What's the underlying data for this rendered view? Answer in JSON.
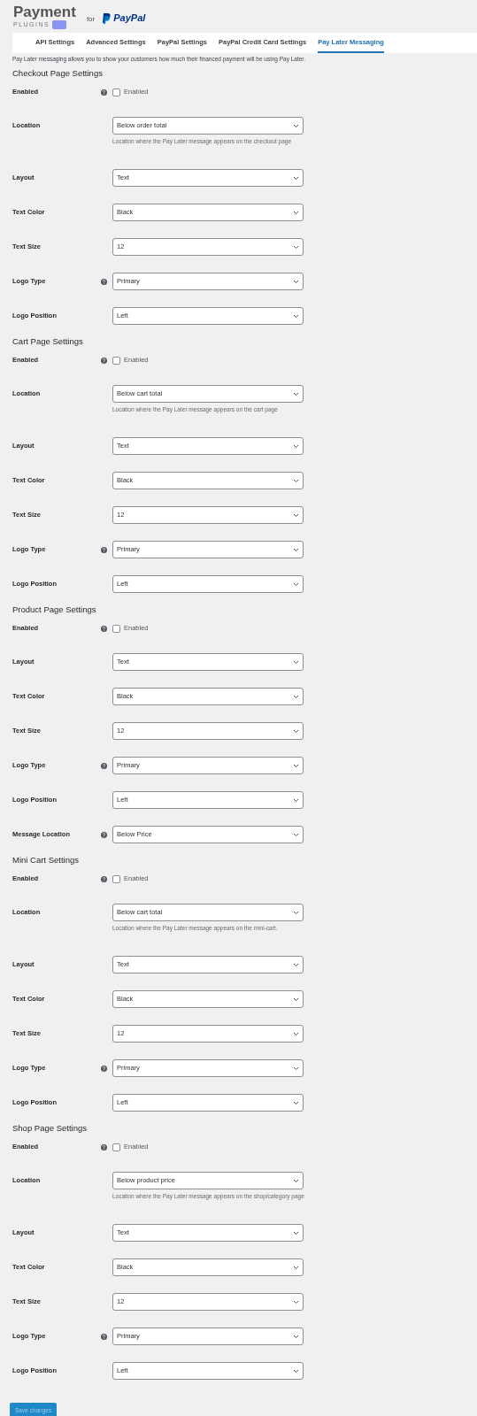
{
  "header": {
    "brand_top": "Payment",
    "brand_bottom": "PLUGINS",
    "connector": "for",
    "partner": "PayPal"
  },
  "tabs": [
    {
      "label": "API Settings",
      "selected": false
    },
    {
      "label": "Advanced Settings",
      "selected": false
    },
    {
      "label": "PayPal Settings",
      "selected": false
    },
    {
      "label": "PayPal Credit Card Settings",
      "selected": false
    },
    {
      "label": "Pay Later Messaging",
      "selected": true
    }
  ],
  "intro": "Pay Later messaging allows you to show your customers how much their financed payment will be using Pay Later.",
  "sections": [
    {
      "title": "Checkout Page Settings",
      "fields": [
        {
          "kind": "checkbox",
          "label": "Enabled",
          "help": true,
          "option": "Enabled",
          "checked": false
        },
        {
          "kind": "select",
          "label": "Location",
          "help": false,
          "value": "Below order total",
          "description": "Location where the Pay Later message appears on the checkout page"
        },
        {
          "kind": "select",
          "label": "Layout",
          "help": false,
          "value": "Text"
        },
        {
          "kind": "select",
          "label": "Text Color",
          "help": false,
          "value": "Black"
        },
        {
          "kind": "select",
          "label": "Text Size",
          "help": false,
          "value": "12"
        },
        {
          "kind": "select",
          "label": "Logo Type",
          "help": true,
          "value": "Primary"
        },
        {
          "kind": "select",
          "label": "Logo Position",
          "help": false,
          "value": "Left"
        }
      ]
    },
    {
      "title": "Cart Page Settings",
      "fields": [
        {
          "kind": "checkbox",
          "label": "Enabled",
          "help": true,
          "option": "Enabled",
          "checked": false
        },
        {
          "kind": "select",
          "label": "Location",
          "help": false,
          "value": "Below cart total",
          "description": "Location where the Pay Later message appears on the cart page"
        },
        {
          "kind": "select",
          "label": "Layout",
          "help": false,
          "value": "Text"
        },
        {
          "kind": "select",
          "label": "Text Color",
          "help": false,
          "value": "Black"
        },
        {
          "kind": "select",
          "label": "Text Size",
          "help": false,
          "value": "12"
        },
        {
          "kind": "select",
          "label": "Logo Type",
          "help": true,
          "value": "Primary"
        },
        {
          "kind": "select",
          "label": "Logo Position",
          "help": false,
          "value": "Left"
        }
      ]
    },
    {
      "title": "Product Page Settings",
      "fields": [
        {
          "kind": "checkbox",
          "label": "Enabled",
          "help": true,
          "option": "Enabled",
          "checked": false
        },
        {
          "kind": "select",
          "label": "Layout",
          "help": false,
          "value": "Text"
        },
        {
          "kind": "select",
          "label": "Text Color",
          "help": false,
          "value": "Black"
        },
        {
          "kind": "select",
          "label": "Text Size",
          "help": false,
          "value": "12"
        },
        {
          "kind": "select",
          "label": "Logo Type",
          "help": true,
          "value": "Primary"
        },
        {
          "kind": "select",
          "label": "Logo Position",
          "help": false,
          "value": "Left"
        },
        {
          "kind": "select",
          "label": "Message Location",
          "help": true,
          "value": "Below Price"
        }
      ]
    },
    {
      "title": "Mini Cart Settings",
      "fields": [
        {
          "kind": "checkbox",
          "label": "Enabled",
          "help": true,
          "option": "Enabled",
          "checked": false
        },
        {
          "kind": "select",
          "label": "Location",
          "help": false,
          "value": "Below cart total",
          "description": "Location where the Pay Later message appears on the mini-cart."
        },
        {
          "kind": "select",
          "label": "Layout",
          "help": false,
          "value": "Text"
        },
        {
          "kind": "select",
          "label": "Text Color",
          "help": false,
          "value": "Black"
        },
        {
          "kind": "select",
          "label": "Text Size",
          "help": false,
          "value": "12"
        },
        {
          "kind": "select",
          "label": "Logo Type",
          "help": true,
          "value": "Primary"
        },
        {
          "kind": "select",
          "label": "Logo Position",
          "help": false,
          "value": "Left"
        }
      ]
    },
    {
      "title": "Shop Page Settings",
      "fields": [
        {
          "kind": "checkbox",
          "label": "Enabled",
          "help": true,
          "option": "Enabled",
          "checked": false
        },
        {
          "kind": "select",
          "label": "Location",
          "help": false,
          "value": "Below product price",
          "description": "Location where the Pay Later message appears on the shop/category page"
        },
        {
          "kind": "select",
          "label": "Layout",
          "help": false,
          "value": "Text"
        },
        {
          "kind": "select",
          "label": "Text Color",
          "help": false,
          "value": "Black"
        },
        {
          "kind": "select",
          "label": "Text Size",
          "help": false,
          "value": "12"
        },
        {
          "kind": "select",
          "label": "Logo Type",
          "help": true,
          "value": "Primary"
        },
        {
          "kind": "select",
          "label": "Logo Position",
          "help": false,
          "value": "Left"
        }
      ]
    }
  ],
  "save_button": "Save changes"
}
